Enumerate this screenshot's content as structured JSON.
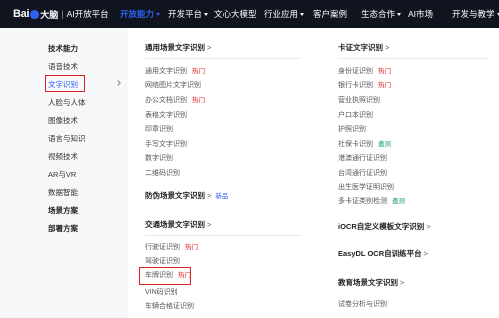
{
  "logo": {
    "brand_a": "Bai",
    "brand_b": "大脑",
    "separator": "|",
    "platform": "AI开放平台"
  },
  "nav": [
    {
      "label": "开放能力",
      "active": true,
      "dropdown": true
    },
    {
      "label": "开发平台",
      "active": false,
      "dropdown": true
    },
    {
      "label": "文心大模型",
      "active": false,
      "dropdown": false
    },
    {
      "label": "行业应用",
      "active": false,
      "dropdown": true
    },
    {
      "label": "客户案例",
      "active": false,
      "dropdown": false
    },
    {
      "label": "生态合作",
      "active": false,
      "dropdown": true
    },
    {
      "label": "AI市场",
      "active": false,
      "dropdown": false
    },
    {
      "label": "开发与教学",
      "active": false,
      "dropdown": true
    }
  ],
  "sidebar": {
    "items": [
      {
        "label": "技术能力",
        "bold": true
      },
      {
        "label": "语音技术",
        "bold": false
      },
      {
        "label": "文字识别",
        "bold": false,
        "selected": true
      },
      {
        "label": "人脸与人体",
        "bold": false
      },
      {
        "label": "图像技术",
        "bold": false
      },
      {
        "label": "语言与知识",
        "bold": false
      },
      {
        "label": "视频技术",
        "bold": false
      },
      {
        "label": "AR与VR",
        "bold": false
      },
      {
        "label": "数据智能",
        "bold": false
      },
      {
        "label": "场景方案",
        "bold": true
      },
      {
        "label": "部署方案",
        "bold": true
      }
    ]
  },
  "tags": {
    "hot": "热门",
    "new": "新品",
    "upgrade": "邀测"
  },
  "sections": {
    "general": {
      "title": "通用场景文字识别",
      "gt": ">",
      "items": [
        {
          "label": "通用文字识别",
          "tag": "热门",
          "tag_type": "hot"
        },
        {
          "label": "网络图片文字识别"
        },
        {
          "label": "办公文档识别",
          "tag": "热门",
          "tag_type": "hot"
        },
        {
          "label": "表格文字识别"
        },
        {
          "label": "印章识别"
        },
        {
          "label": "手写文字识别"
        },
        {
          "label": "数字识别"
        },
        {
          "label": "二维码识别"
        }
      ]
    },
    "card": {
      "title": "卡证文字识别",
      "gt": ">",
      "items": [
        {
          "label": "身份证识别",
          "tag": "热门",
          "tag_type": "hot"
        },
        {
          "label": "银行卡识别",
          "tag": "热门",
          "tag_type": "hot"
        },
        {
          "label": "营业执照识别"
        },
        {
          "label": "户口本识别"
        },
        {
          "label": "护照识别"
        },
        {
          "label": "社保卡识别",
          "tag": "邀测",
          "tag_type": "new"
        },
        {
          "label": "港澳通行证识别"
        },
        {
          "label": "台湾通行证识别"
        },
        {
          "label": "出生医学证明识别"
        },
        {
          "label": "多卡证类别检测",
          "tag": "邀测",
          "tag_type": "new"
        }
      ]
    },
    "anticounterfeit": {
      "title": "防伪场景文字识别",
      "gt": ">",
      "tag": "新品"
    },
    "traffic": {
      "title": "交通场景文字识别",
      "gt": ">",
      "items": [
        {
          "label": "行驶证识别",
          "tag": "热门",
          "tag_type": "hot"
        },
        {
          "label": "驾驶证识别"
        },
        {
          "label": "车牌识别",
          "tag": "热门",
          "tag_type": "hot",
          "highlighted": true
        },
        {
          "label": "VIN码识别"
        },
        {
          "label": "车辆合格证识别"
        }
      ]
    },
    "custom": {
      "title": "iOCR自定义模板文字识别",
      "gt": ">"
    },
    "easydl": {
      "title": "EasyDL OCR自训练平台",
      "gt": ">"
    },
    "education": {
      "title": "教育场景文字识别",
      "gt": ">",
      "items": [
        {
          "label": "试卷分析与识别"
        }
      ]
    }
  }
}
